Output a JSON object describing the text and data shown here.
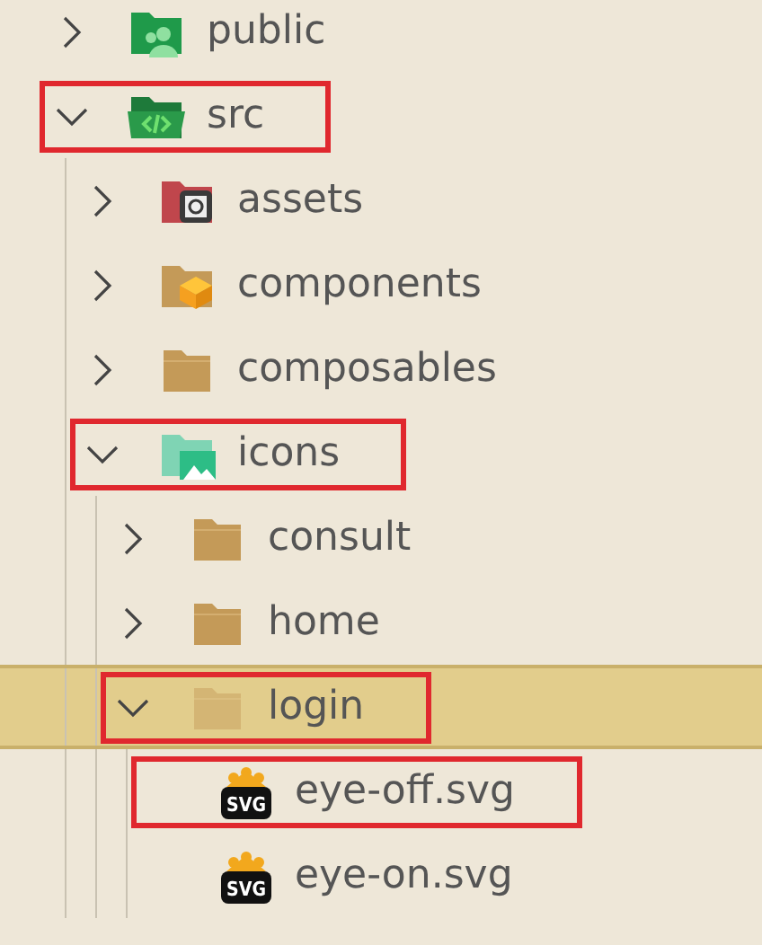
{
  "tree": [
    {
      "name": "public",
      "kind": "people-folder",
      "expanded": false,
      "selected": false,
      "highlighted": false
    },
    {
      "name": "src",
      "kind": "code-folder",
      "expanded": true,
      "selected": false,
      "highlighted": true,
      "children": [
        {
          "name": "assets",
          "kind": "gear-folder",
          "expanded": false,
          "selected": false,
          "highlighted": false
        },
        {
          "name": "components",
          "kind": "block-folder",
          "expanded": false,
          "selected": false,
          "highlighted": false
        },
        {
          "name": "composables",
          "kind": "folder",
          "expanded": false,
          "selected": false,
          "highlighted": false
        },
        {
          "name": "icons",
          "kind": "image-folder",
          "expanded": true,
          "selected": false,
          "highlighted": true,
          "children": [
            {
              "name": "consult",
              "kind": "folder",
              "expanded": false,
              "selected": false,
              "highlighted": false
            },
            {
              "name": "home",
              "kind": "folder",
              "expanded": false,
              "selected": false,
              "highlighted": false
            },
            {
              "name": "login",
              "kind": "folder",
              "expanded": true,
              "selected": true,
              "highlighted": true,
              "children": [
                {
                  "name": "eye-off.svg",
                  "kind": "file",
                  "badge": "SVG",
                  "selected": false,
                  "highlighted": true
                },
                {
                  "name": "eye-on.svg",
                  "kind": "file",
                  "badge": "SVG",
                  "selected": false,
                  "highlighted": false
                }
              ]
            }
          ]
        }
      ]
    }
  ]
}
